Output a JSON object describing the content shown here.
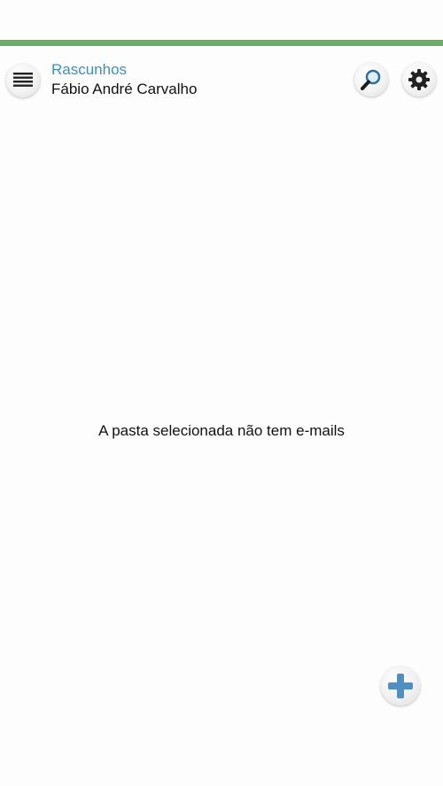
{
  "header": {
    "folder_name": "Rascunhos",
    "account_name": "Fábio André Carvalho",
    "icons": {
      "menu": "menu-icon",
      "search": "search-icon",
      "settings": "gear-icon"
    }
  },
  "main": {
    "empty_message": "A pasta selecionada não tem e-mails"
  },
  "fab": {
    "icon": "plus-icon"
  },
  "colors": {
    "accent_bar": "#6aad66",
    "folder_title": "#3d8fc0",
    "fab_plus": "#4f8fc4"
  }
}
